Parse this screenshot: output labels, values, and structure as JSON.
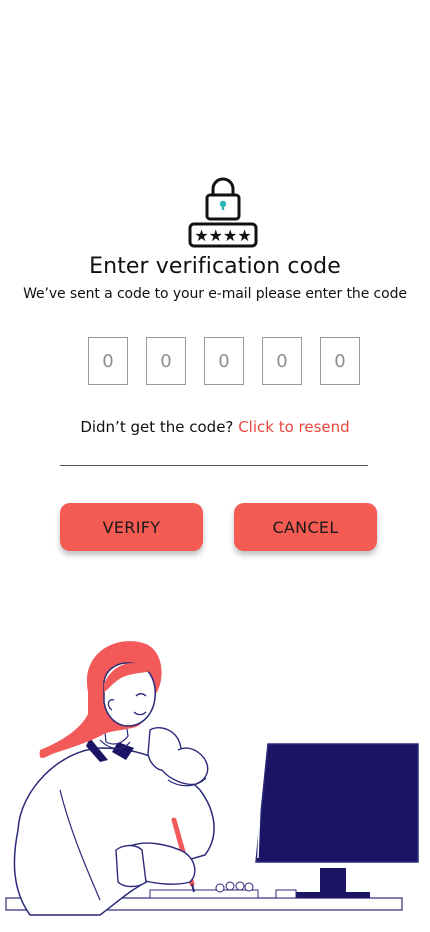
{
  "header": {
    "title": "Enter verification code",
    "subtitle": "We’ve sent a code to your e-mail please enter the code"
  },
  "icons": {
    "lock": "padlock-password-icon"
  },
  "code": {
    "digits": [
      {
        "placeholder": "0",
        "value": ""
      },
      {
        "placeholder": "0",
        "value": ""
      },
      {
        "placeholder": "0",
        "value": ""
      },
      {
        "placeholder": "0",
        "value": ""
      },
      {
        "placeholder": "0",
        "value": ""
      }
    ]
  },
  "resend": {
    "prompt": "Didn’t get the code?",
    "link": "Click to resend"
  },
  "actions": {
    "verify_label": "VERIFY",
    "cancel_label": "CANCEL"
  },
  "colors": {
    "accent": "#f45b52",
    "link": "#e9473c",
    "monitor": "#1b1464",
    "outline": "#2b2a7a",
    "hair": "#f25a5a"
  }
}
